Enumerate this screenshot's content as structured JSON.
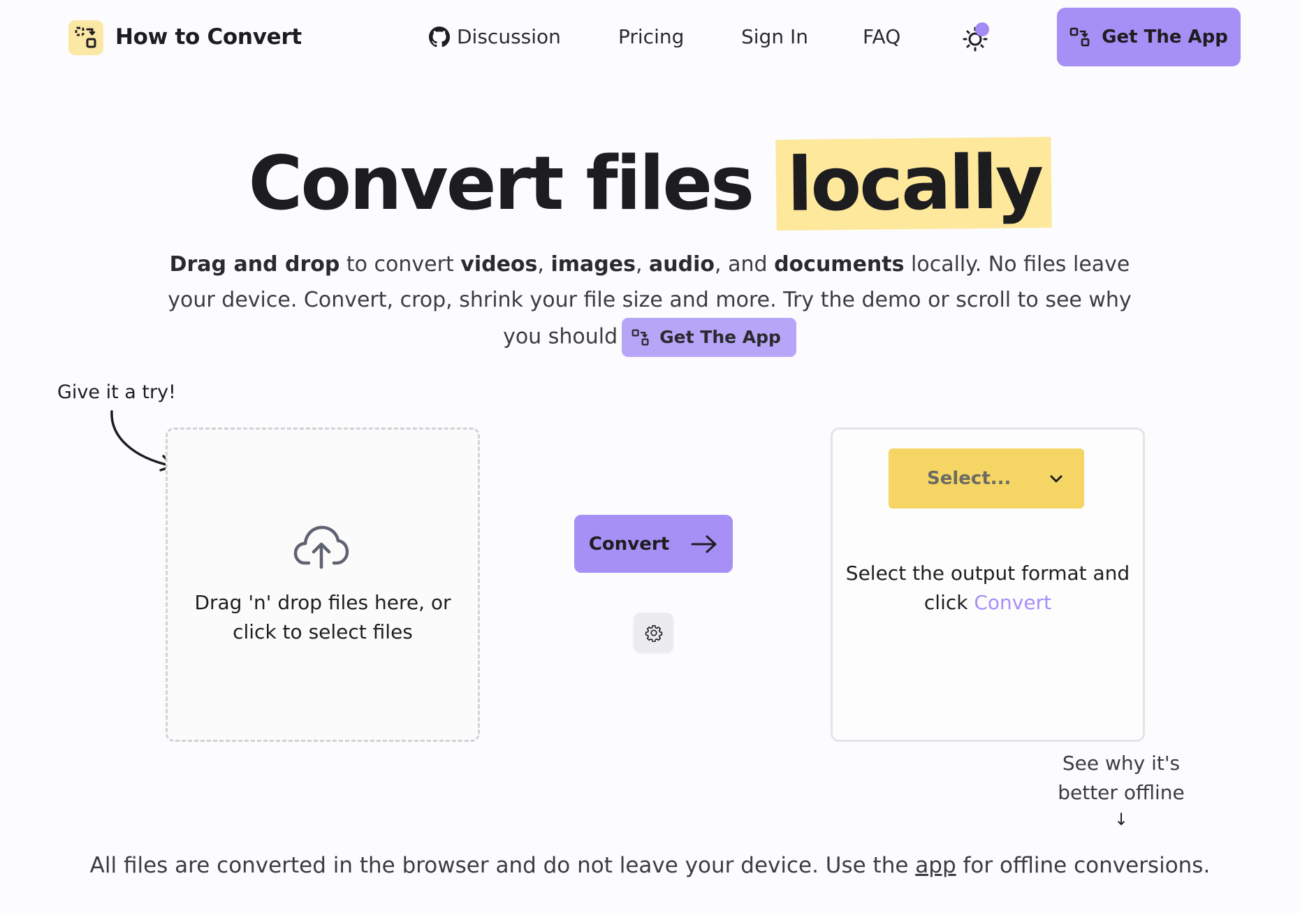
{
  "header": {
    "brand": "How to Convert",
    "nav": {
      "discussion": "Discussion",
      "pricing": "Pricing",
      "signin": "Sign In",
      "faq": "FAQ"
    },
    "cta_label": "Get The App",
    "icons": {
      "logo": "convert-logo-icon",
      "github": "github-icon",
      "theme": "sun-icon",
      "cta": "app-icon"
    }
  },
  "hero": {
    "title_main": "Convert files",
    "title_highlight": "locally",
    "sub": {
      "p1_bold": "Drag and drop",
      "p2": " to convert ",
      "p3_bold": "videos",
      "p4": ", ",
      "p5_bold": "images",
      "p6": ", ",
      "p7_bold": "audio",
      "p8": ", and ",
      "p9_bold": "documents",
      "p10": " locally. No files leave your device. Convert, crop, shrink your file size and more. Try the demo or scroll to see why you should",
      "cta_label": "Get The App"
    }
  },
  "demo": {
    "try_label": "Give it a try!",
    "dropzone": {
      "line1": "Drag 'n' drop files here, or",
      "line2": "click to select files",
      "icon": "cloud-upload-icon"
    },
    "convert_label": "Convert",
    "settings_icon": "gear-icon",
    "select": {
      "placeholder": "Select...",
      "icon": "chevron-down-icon"
    },
    "output_hint": {
      "line1": "Select the output format and",
      "line2_prefix": "click ",
      "line2_accent": "Convert"
    },
    "offline_link": {
      "line1": "See why it's",
      "line2": "better offline",
      "arrow": "↓"
    }
  },
  "footer": {
    "text_before": "All files are converted in the browser and do not leave your device. Use the ",
    "link_text": "app",
    "text_after": " for offline conversions."
  },
  "colors": {
    "accent": "#a68ff5",
    "highlight": "#fde89c",
    "select_bg": "#f5d665",
    "logo_bg": "#fbe8a4"
  }
}
